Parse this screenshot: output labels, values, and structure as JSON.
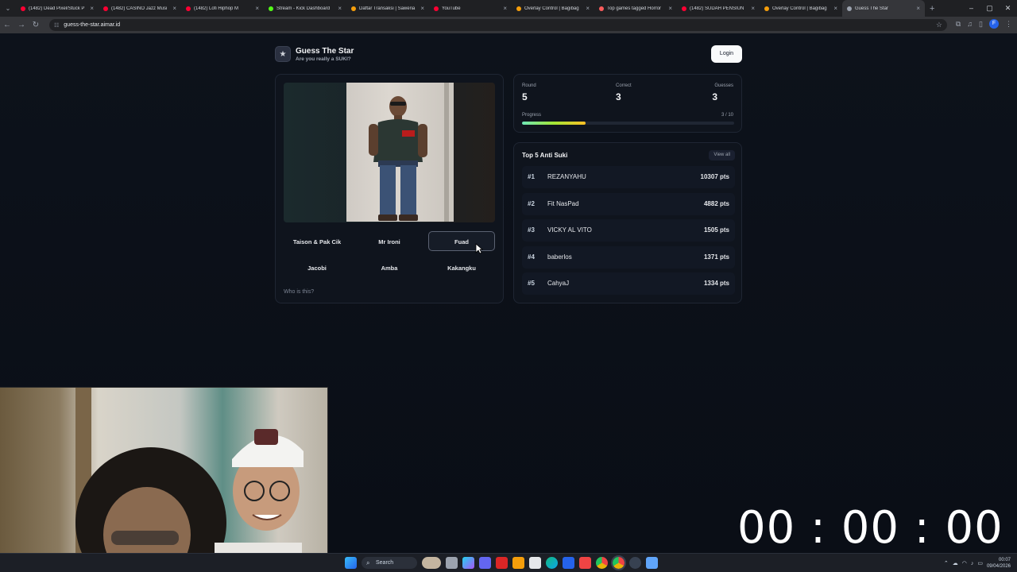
{
  "browser": {
    "tabs": [
      {
        "title": "(1482) Dead Pixel/Stuck P",
        "fav_color": "#ff0033"
      },
      {
        "title": "(1482) CASINO Jazz Musi",
        "fav_color": "#ff0033"
      },
      {
        "title": "(1482) Lofi Hiphop M",
        "fav_color": "#ff0033"
      },
      {
        "title": "Stream - Kick Dashboard",
        "fav_color": "#53fc18"
      },
      {
        "title": "Daftar Transaksi | Saweria",
        "fav_color": "#f59e0b"
      },
      {
        "title": "YouTube",
        "fav_color": "#ff0033"
      },
      {
        "title": "Overlay Control | Bagibag",
        "fav_color": "#f59e0b"
      },
      {
        "title": "Top games tagged Horror",
        "fav_color": "#fa5c5c"
      },
      {
        "title": "(1482) SUDAH PENSIUN",
        "fav_color": "#ff0033"
      },
      {
        "title": "Overlay Control | Bagibag",
        "fav_color": "#f59e0b"
      },
      {
        "title": "Guess The Star",
        "fav_color": "#9ca3af"
      }
    ],
    "url": "guess-the-star.aimar.id"
  },
  "header": {
    "title": "Guess The Star",
    "subtitle": "Are you really a SUKI?",
    "login_label": "Login"
  },
  "game": {
    "choices": [
      "Taison & Pak Cik",
      "Mr Ironi",
      "Fuad",
      "Jacobi",
      "Amba",
      "Kakangku"
    ],
    "hovered_choice": "Fuad",
    "prompt": "Who is this?"
  },
  "stats": {
    "round_label": "Round",
    "round_value": "5",
    "correct_label": "Correct",
    "correct_value": "3",
    "guesses_label": "Guesses",
    "guesses_value": "3",
    "progress_label": "Progress",
    "progress_text": "3 / 10",
    "progress_fraction": 0.3
  },
  "leaderboard": {
    "title": "Top 5 Anti Suki",
    "view_all": "View all",
    "rows": [
      {
        "rank": "#1",
        "name": "REZANYAHU",
        "points": "10307 pts"
      },
      {
        "rank": "#2",
        "name": "Fit NasPad",
        "points": "4882 pts"
      },
      {
        "rank": "#3",
        "name": "VICKY AL VITO",
        "points": "1505 pts"
      },
      {
        "rank": "#4",
        "name": "baberlos",
        "points": "1371 pts"
      },
      {
        "rank": "#5",
        "name": "CahyaJ",
        "points": "1334 pts"
      }
    ]
  },
  "overlay": {
    "timer": "00 : 00 : 00"
  },
  "taskbar": {
    "search_label": "Search",
    "time": "00:07",
    "date": "09/04/2026"
  }
}
